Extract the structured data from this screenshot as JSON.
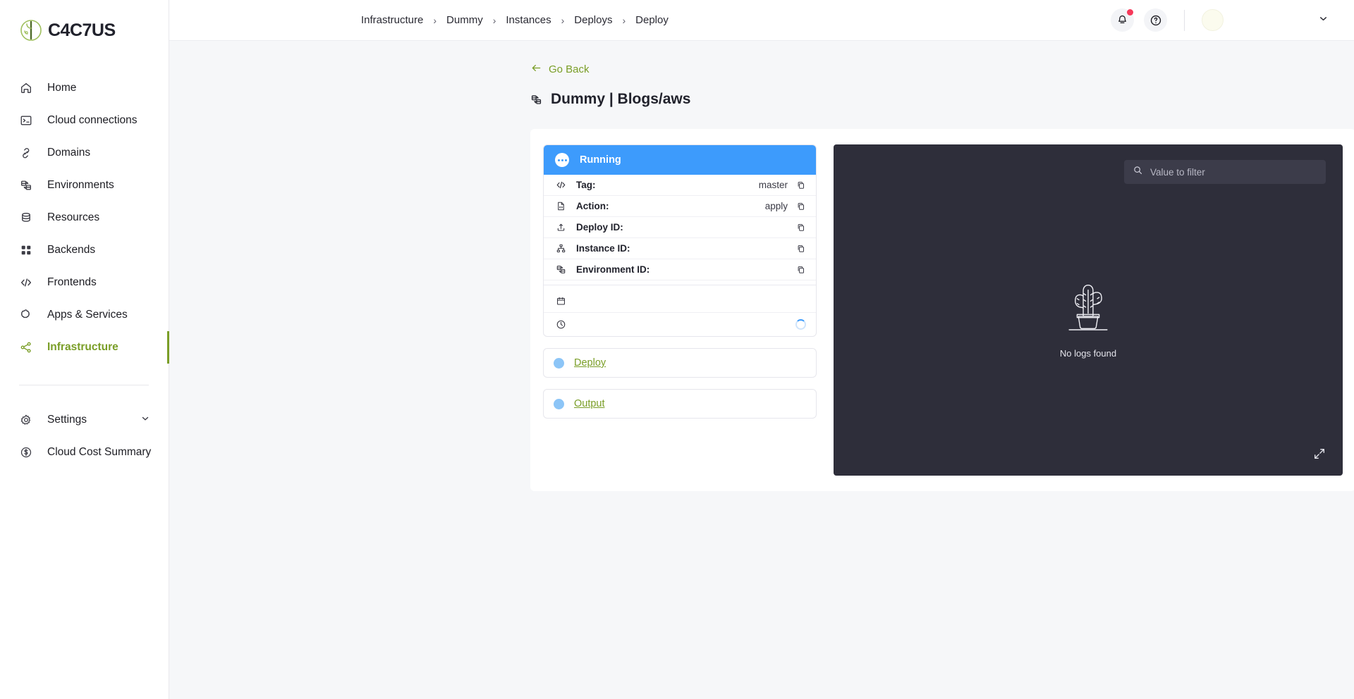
{
  "brand": {
    "name": "C4C7US",
    "accent": "#7a9e27"
  },
  "sidebar": {
    "items": [
      {
        "label": "Home",
        "icon": "home-icon"
      },
      {
        "label": "Cloud connections",
        "icon": "terminal-icon"
      },
      {
        "label": "Domains",
        "icon": "link-icon"
      },
      {
        "label": "Environments",
        "icon": "swap-icon"
      },
      {
        "label": "Resources",
        "icon": "database-icon"
      },
      {
        "label": "Backends",
        "icon": "grid-icon"
      },
      {
        "label": "Frontends",
        "icon": "code-icon"
      },
      {
        "label": "Apps & Services",
        "icon": "puzzle-icon"
      },
      {
        "label": "Infrastructure",
        "icon": "share-nodes-icon",
        "active": true
      }
    ],
    "footer_items": [
      {
        "label": "Settings",
        "icon": "gear-icon",
        "has_chevron": true
      },
      {
        "label": "Cloud Cost Summary",
        "icon": "dollar-circle-icon"
      }
    ]
  },
  "topbar": {
    "breadcrumb": [
      "Infrastructure",
      "Dummy",
      "Instances",
      "Deploys",
      "Deploy"
    ],
    "separator": "›",
    "notifications_icon": "bell-icon",
    "help_icon": "question-circle-icon",
    "user_chevron_icon": "chevron-down-icon"
  },
  "page": {
    "go_back": "Go Back",
    "back_icon": "arrow-left-icon",
    "title": "Dummy | Blogs/aws",
    "title_icon": "swap-icon"
  },
  "deploy_card": {
    "status": "Running",
    "status_color": "#3d9bfc",
    "status_icon": "dots-circle-icon",
    "rows": [
      {
        "icon": "code-icon",
        "key": "Tag:",
        "value": "master",
        "copy": true
      },
      {
        "icon": "file-code-icon",
        "key": "Action:",
        "value": "apply",
        "copy": true
      },
      {
        "icon": "upload-icon",
        "key": "Deploy ID:",
        "value": "",
        "copy": true
      },
      {
        "icon": "sitemap-icon",
        "key": "Instance ID:",
        "value": "",
        "copy": true
      },
      {
        "icon": "swap-icon",
        "key": "Environment ID:",
        "value": "",
        "copy": true
      }
    ],
    "meta_rows": [
      {
        "icon": "calendar-icon",
        "value": ""
      },
      {
        "icon": "clock-icon",
        "value": "",
        "loading": true
      }
    ],
    "links": [
      {
        "label": "Deploy"
      },
      {
        "label": "Output"
      }
    ]
  },
  "logs": {
    "filter_placeholder": "Value to filter",
    "filter_value": "",
    "search_icon": "search-icon",
    "empty_text": "No logs found",
    "empty_icon": "cactus-icon",
    "expand_icon": "expand-icon",
    "background": "#2e2e3a"
  }
}
